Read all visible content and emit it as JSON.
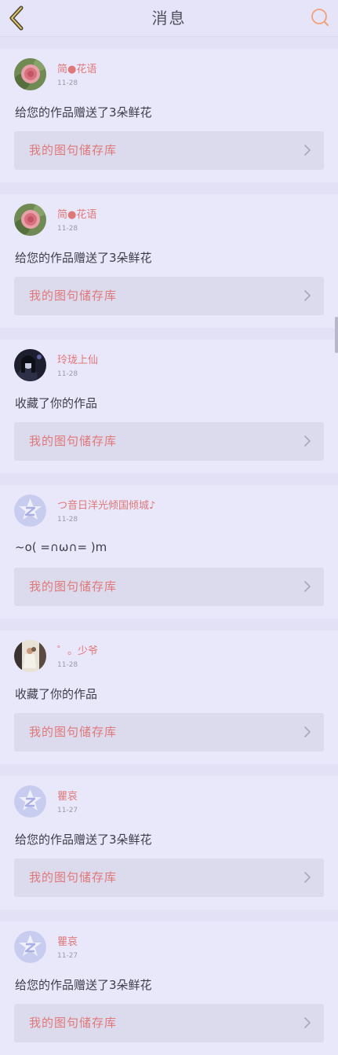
{
  "header": {
    "title": "消息"
  },
  "messages": [
    {
      "name": "简●花语",
      "date": "11-28",
      "text": "给您的作品赠送了3朵鲜花",
      "link": "我的图句储存库",
      "avatar": "flower"
    },
    {
      "name": "简●花语",
      "date": "11-28",
      "text": "给您的作品赠送了3朵鲜花",
      "link": "我的图句储存库",
      "avatar": "flower"
    },
    {
      "name": "玲珑上仙",
      "date": "11-28",
      "text": "收藏了你的作品",
      "link": "我的图句储存库",
      "avatar": "dark-portrait"
    },
    {
      "name": "つ音日洋光倾国倾城♪",
      "date": "11-28",
      "text": "~o( =∩ω∩= )m",
      "link": "我的图句储存库",
      "avatar": "default"
    },
    {
      "name": "゜。少爷",
      "date": "11-28",
      "text": "收藏了你的作品",
      "link": "我的图句储存库",
      "avatar": "photo"
    },
    {
      "name": "瞿哀",
      "date": "11-27",
      "text": "给您的作品赠送了3朵鲜花",
      "link": "我的图句储存库",
      "avatar": "default"
    },
    {
      "name": "瞿哀",
      "date": "11-27",
      "text": "给您的作品赠送了3朵鲜花",
      "link": "我的图句储存库",
      "avatar": "default"
    }
  ],
  "colors": {
    "accent": "#e07878",
    "background": "#e3e1f5",
    "card": "#e9e7fa",
    "linkBox": "#dcdaed"
  }
}
